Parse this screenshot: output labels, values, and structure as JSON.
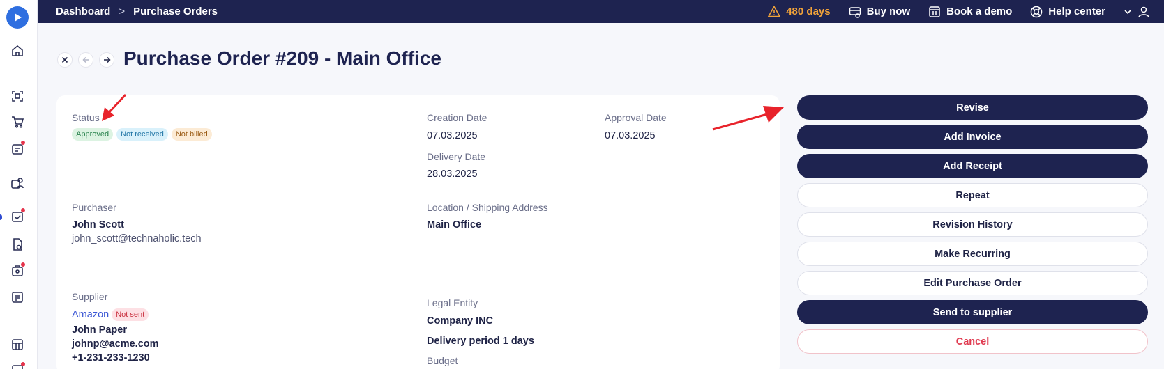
{
  "breadcrumb": {
    "items": [
      "Dashboard",
      "Purchase Orders"
    ],
    "separator": ">"
  },
  "topbar": {
    "warning_text": "480 days",
    "buy_now": "Buy now",
    "book_demo": "Book a demo",
    "help_center": "Help center"
  },
  "page": {
    "title": "Purchase Order #209 - Main Office"
  },
  "details": {
    "status_label": "Status",
    "status_badges": [
      "Approved",
      "Not received",
      "Not billed"
    ],
    "creation_date_label": "Creation Date",
    "creation_date": "07.03.2025",
    "approval_date_label": "Approval Date",
    "approval_date": "07.03.2025",
    "delivery_date_label": "Delivery Date",
    "delivery_date": "28.03.2025",
    "purchaser_label": "Purchaser",
    "purchaser_name": "John Scott",
    "purchaser_email": "john_scott@technaholic.tech",
    "location_label": "Location / Shipping Address",
    "location": "Main Office",
    "supplier_label": "Supplier",
    "supplier_name": "Amazon",
    "supplier_badge": "Not sent",
    "supplier_contact": "John Paper",
    "supplier_email": "johnp@acme.com",
    "supplier_phone": "+1-231-233-1230",
    "legal_entity_label": "Legal Entity",
    "legal_entity": "Company INC",
    "delivery_period": "Delivery period 1 days",
    "budget_label": "Budget"
  },
  "actions": {
    "revise": "Revise",
    "add_invoice": "Add Invoice",
    "add_receipt": "Add Receipt",
    "repeat": "Repeat",
    "revision_history": "Revision History",
    "make_recurring": "Make Recurring",
    "edit_po": "Edit Purchase Order",
    "send_supplier": "Send to supplier",
    "cancel": "Cancel"
  },
  "colors": {
    "navy": "#1e2350",
    "accent_blue": "#2f6fe0",
    "warning": "#f2a33a",
    "danger": "#e0394f",
    "annotation_arrow": "#e8232b"
  },
  "icons": [
    "logo-icon",
    "home-icon",
    "scan-icon",
    "cart-icon",
    "invoice-icon",
    "users-icon",
    "approval-icon",
    "document-icon",
    "budget-icon",
    "reports-icon",
    "calculator-icon",
    "warning-icon",
    "buy-icon",
    "calendar-icon",
    "help-icon",
    "chevron-down-icon",
    "user-icon",
    "close-icon",
    "arrow-left-icon",
    "arrow-right-icon"
  ]
}
